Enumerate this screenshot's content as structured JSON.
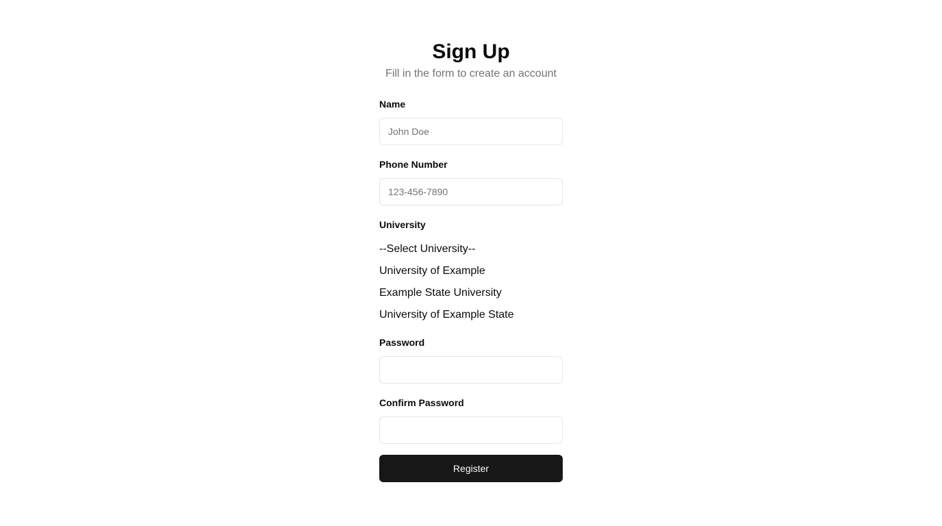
{
  "header": {
    "title": "Sign Up",
    "subtitle": "Fill in the form to create an account"
  },
  "form": {
    "name": {
      "label": "Name",
      "placeholder": "John Doe",
      "value": ""
    },
    "phone": {
      "label": "Phone Number",
      "placeholder": "123-456-7890",
      "value": ""
    },
    "university": {
      "label": "University",
      "options": [
        "--Select University--",
        "University of Example",
        "Example State University",
        "University of Example State"
      ]
    },
    "password": {
      "label": "Password",
      "value": ""
    },
    "confirm_password": {
      "label": "Confirm Password",
      "value": ""
    },
    "submit_label": "Register"
  },
  "colors": {
    "background": "#ffffff",
    "text": "#0a0a0a",
    "muted_text": "#737373",
    "border": "#e5e5e5",
    "button_bg": "#171717",
    "button_text": "#fafafa"
  }
}
